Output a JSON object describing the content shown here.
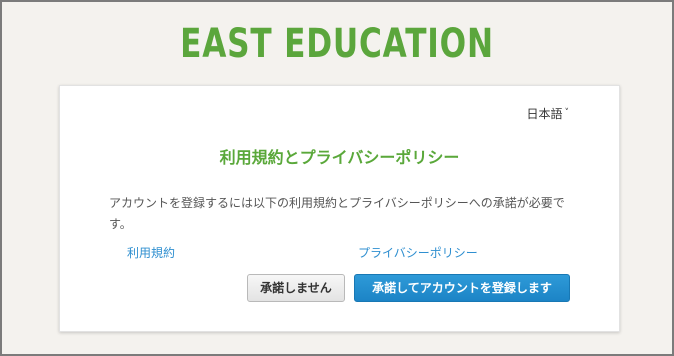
{
  "brand": {
    "logo_text": "EAST EDUCATION",
    "color": "#5ba63c"
  },
  "language_selector": {
    "label": "日本語",
    "chevron": "˅"
  },
  "dialog": {
    "title": "利用規約とプライバシーポリシー",
    "description": "アカウントを登録するには以下の利用規約とプライバシーポリシーへの承諾が必要です。",
    "links": {
      "terms": "利用規約",
      "privacy": "プライバシーポリシー"
    },
    "buttons": {
      "decline": "承諾しません",
      "accept": "承諾してアカウントを登録します"
    }
  },
  "colors": {
    "title_green": "#5aa83a",
    "link_blue": "#2f8fd0",
    "accept_button_blue": "#1c84c6"
  }
}
